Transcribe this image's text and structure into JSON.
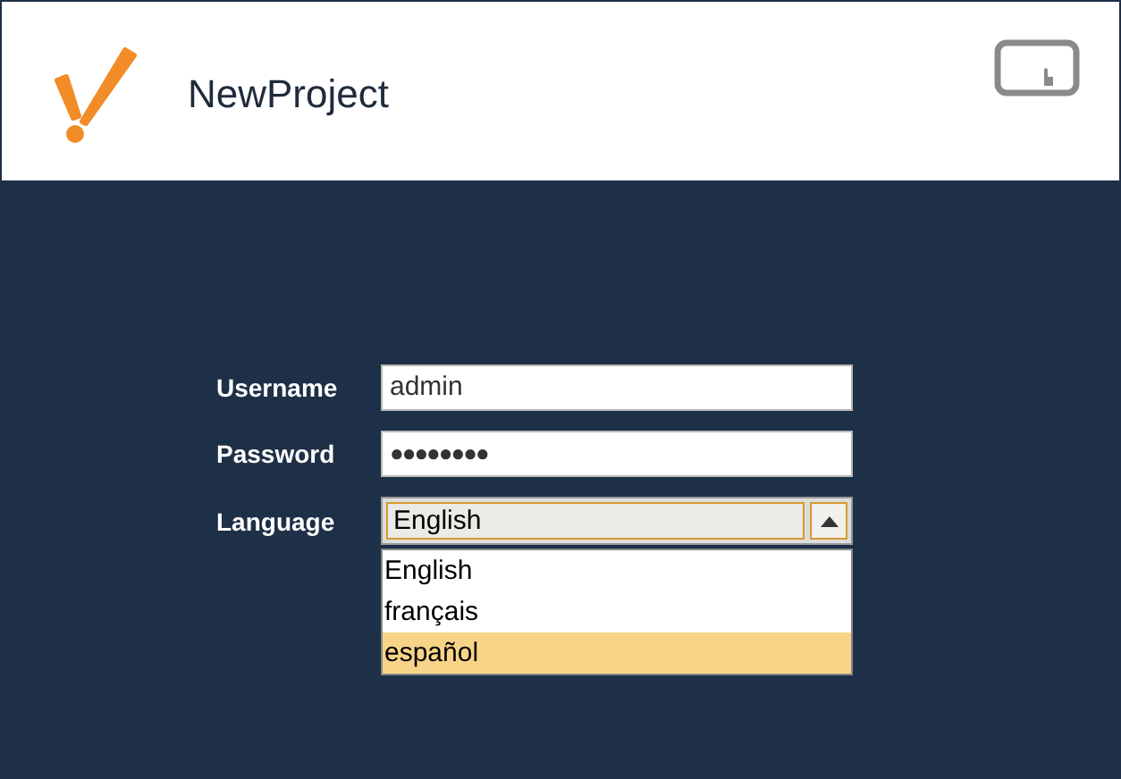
{
  "header": {
    "title": "NewProject"
  },
  "form": {
    "username": {
      "label": "Username",
      "value": "admin"
    },
    "password": {
      "label": "Password",
      "value": "●●●●●●●●"
    },
    "language": {
      "label": "Language",
      "value": "English",
      "expanded": true,
      "options": [
        {
          "label": "English",
          "highlighted": false
        },
        {
          "label": "français",
          "highlighted": false
        },
        {
          "label": "español",
          "highlighted": true
        }
      ]
    }
  }
}
